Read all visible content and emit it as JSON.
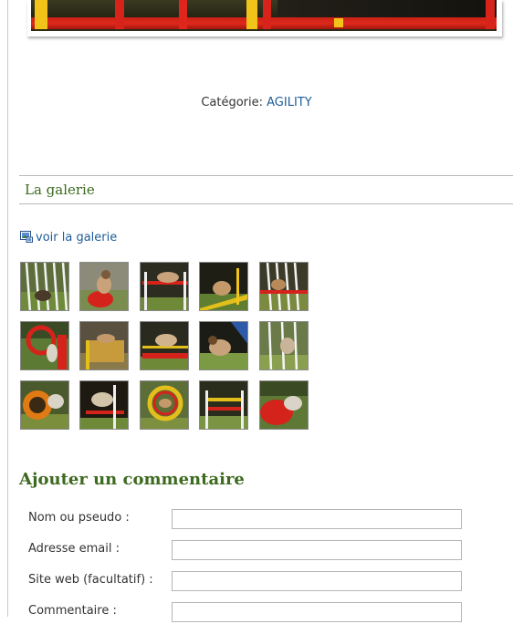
{
  "article": {
    "category_label": "Catégorie:",
    "category_value": "AGILITY"
  },
  "gallery": {
    "title": "La galerie",
    "link_label": "voir la galerie",
    "thumbnails": [
      {
        "name": "thumb-1",
        "scene": "weave-poles"
      },
      {
        "name": "thumb-2",
        "scene": "red-tunnel-dog"
      },
      {
        "name": "thumb-3",
        "scene": "jump-red-bar"
      },
      {
        "name": "thumb-4",
        "scene": "dog-on-seesaw"
      },
      {
        "name": "thumb-5",
        "scene": "weave-poles-red"
      },
      {
        "name": "thumb-6",
        "scene": "tire-jump"
      },
      {
        "name": "thumb-7",
        "scene": "wooden-wall"
      },
      {
        "name": "thumb-8",
        "scene": "jump-red-bar"
      },
      {
        "name": "thumb-9",
        "scene": "dog-running"
      },
      {
        "name": "thumb-10",
        "scene": "weave-poles"
      },
      {
        "name": "thumb-11",
        "scene": "orange-tunnel"
      },
      {
        "name": "thumb-12",
        "scene": "dog-jump-dark"
      },
      {
        "name": "thumb-13",
        "scene": "tire-jump-red"
      },
      {
        "name": "thumb-14",
        "scene": "jump-bar"
      },
      {
        "name": "thumb-15",
        "scene": "red-tunnel-dog"
      }
    ]
  },
  "comment_form": {
    "title": "Ajouter un commentaire",
    "name_label": "Nom ou pseudo :",
    "name_value": "",
    "email_label": "Adresse email :",
    "email_value": "",
    "website_label": "Site web (facultatif) :",
    "website_value": "",
    "comment_label": "Commentaire :",
    "comment_value": ""
  },
  "colors": {
    "link": "#1f5c99",
    "heading_green": "#3c6a1e",
    "rule_gray": "#b9b9b9"
  }
}
